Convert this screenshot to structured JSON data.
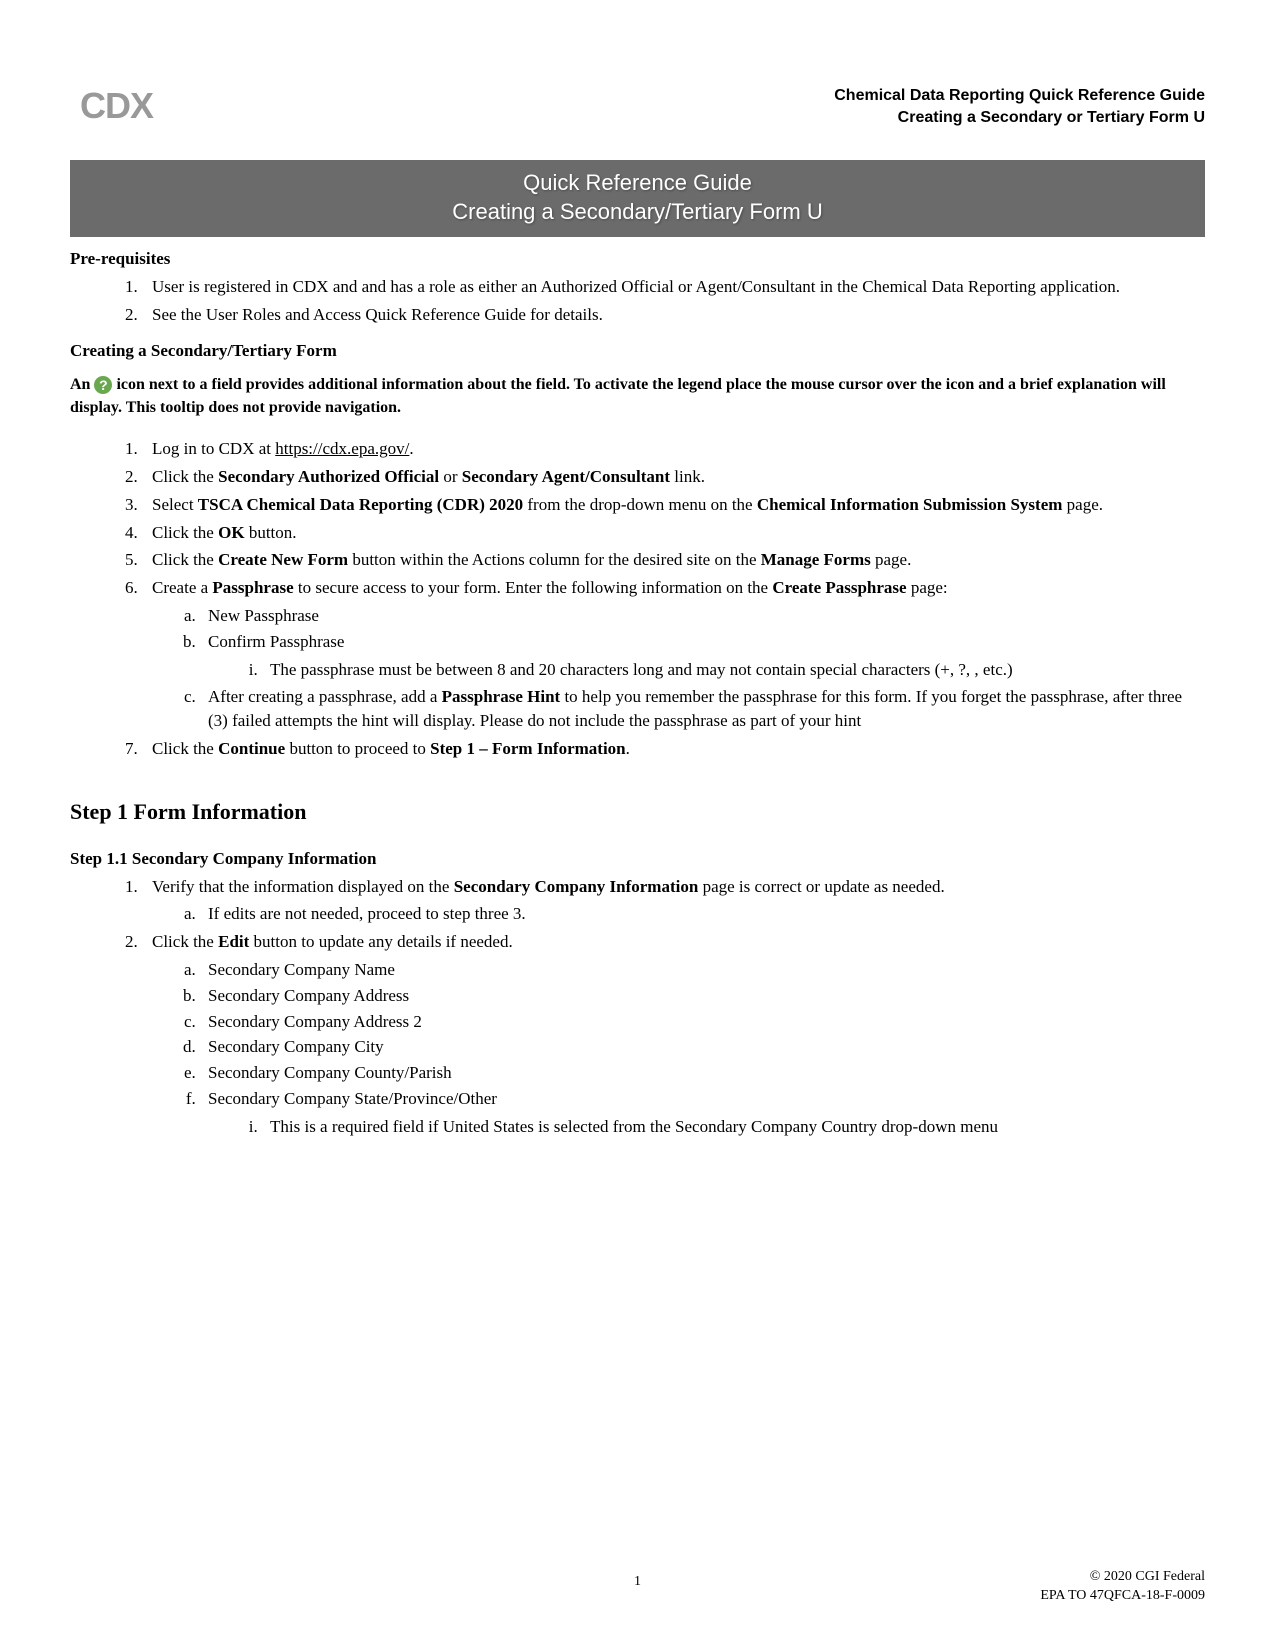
{
  "logo": "CDX",
  "header": {
    "line1": "Chemical Data Reporting Quick Reference Guide",
    "line2": "Creating a Secondary or Tertiary Form U"
  },
  "banner": {
    "line1": "Quick Reference Guide",
    "line2": "Creating a Secondary/Tertiary Form U"
  },
  "prereq_heading": "Pre-requisites",
  "prereq": [
    "User is registered in CDX and and has a role as either an Authorized Official or Agent/Consultant in the Chemical Data Reporting application.",
    "See the User Roles and Access Quick Reference Guide for details."
  ],
  "creating_heading": "Creating a Secondary/Tertiary Form",
  "note_prefix": "An ",
  "note_suffix": " icon next to a field provides additional information about the field. To activate the legend place the mouse cursor over the icon and a brief explanation will display. This tooltip does not provide navigation.",
  "login_url": "https://cdx.epa.gov/",
  "steps": {
    "s1_pre": "Log in to CDX at ",
    "s1_post": ".",
    "s2_a": "Click the ",
    "s2_b": "Secondary Authorized Official",
    "s2_c": " or ",
    "s2_d": "Secondary Agent/Consultant",
    "s2_e": " link.",
    "s3_a": "Select ",
    "s3_b": "TSCA Chemical Data Reporting (CDR) 2020",
    "s3_c": " from the drop-down menu on the ",
    "s3_d": "Chemical Information Submission System",
    "s3_e": " page.",
    "s4_a": "Click the ",
    "s4_b": "OK",
    "s4_c": " button.",
    "s5_a": "Click the ",
    "s5_b": "Create New Form",
    "s5_c": " button within the Actions column for the desired site on the ",
    "s5_d": "Manage Forms",
    "s5_e": " page.",
    "s6_a": "Create a ",
    "s6_b": "Passphrase",
    "s6_c": " to secure access to your form. Enter the following information on the ",
    "s6_d": "Create Passphrase",
    "s6_e": " page:",
    "s6_sub_a": "New Passphrase",
    "s6_sub_b": "Confirm Passphrase",
    "s6_sub_b_i": "The passphrase must be between 8 and 20 characters long and may not contain special characters (+, ?, , etc.)",
    "s6_sub_c_a": "After creating a passphrase, add a ",
    "s6_sub_c_b": "Passphrase Hint",
    "s6_sub_c_c": " to help you remember the passphrase for this form. If you forget the passphrase, after three (3) failed attempts the hint will display. Please do not include the passphrase as part of your hint",
    "s7_a": "Click the ",
    "s7_b": "Continue",
    "s7_c": " button to proceed to ",
    "s7_d": "Step 1 – Form Information",
    "s7_e": "."
  },
  "step1_heading": "Step 1 Form Information",
  "step11_heading": "Step 1.1 Secondary Company Information",
  "sci": {
    "i1_a": "Verify that the information displayed on the ",
    "i1_b": "Secondary Company Information",
    "i1_c": " page is correct or update as needed.",
    "i1_sub_a": "If edits are not needed, proceed to step three 3.",
    "i2_a": "Click the ",
    "i2_b": "Edit",
    "i2_c": " button to update any details if needed.",
    "i2_sub": [
      "Secondary Company Name",
      "Secondary Company Address",
      "Secondary Company Address 2",
      "Secondary Company City",
      "Secondary Company County/Parish",
      "Secondary Company State/Province/Other"
    ],
    "i2_sub_f_i": "This is a required field if United States is selected from the Secondary Company Country drop-down menu"
  },
  "footer": {
    "page": "1",
    "line1": "© 2020 CGI Federal",
    "line2": "EPA TO 47QFCA-18-F-0009"
  }
}
